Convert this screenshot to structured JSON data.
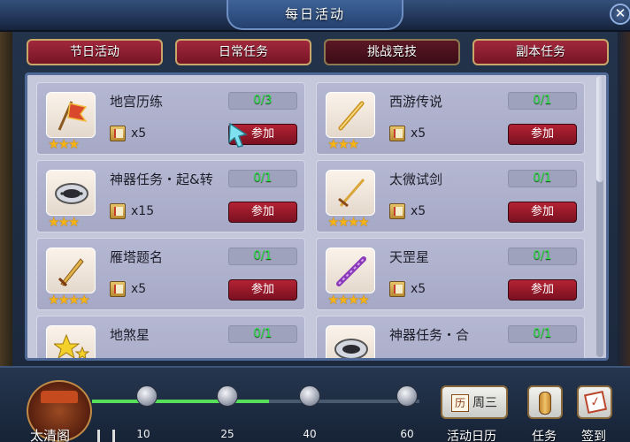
{
  "window": {
    "title": "每日活动",
    "close_glyph": "✕"
  },
  "tabs": [
    {
      "label": "节日活动",
      "active": false
    },
    {
      "label": "日常任务",
      "active": false
    },
    {
      "label": "挑战竞技",
      "active": true
    },
    {
      "label": "副本任务",
      "active": false
    }
  ],
  "activities": [
    {
      "name": "地宫历练",
      "progress": "0/3",
      "stars": "★★★",
      "reward_qty": "x5",
      "join_label": "参加",
      "icon": "banner-flag-icon"
    },
    {
      "name": "西游传说",
      "progress": "0/1",
      "stars": "★★★",
      "reward_qty": "x5",
      "join_label": "参加",
      "icon": "golden-flute-icon"
    },
    {
      "name": "神器任务・起&转",
      "progress": "0/1",
      "stars": "★★★",
      "reward_qty": "x15",
      "join_label": "参加",
      "icon": "artifact-disc-icon"
    },
    {
      "name": "太微试剑",
      "progress": "0/1",
      "stars": "★★★★",
      "reward_qty": "x5",
      "join_label": "参加",
      "icon": "golden-sword-icon"
    },
    {
      "name": "雁塔题名",
      "progress": "0/1",
      "stars": "★★★★",
      "reward_qty": "x5",
      "join_label": "参加",
      "icon": "golden-blade-icon"
    },
    {
      "name": "天罡星",
      "progress": "0/1",
      "stars": "★★★★",
      "reward_qty": "x5",
      "join_label": "参加",
      "icon": "purple-staff-icon"
    },
    {
      "name": "地煞星",
      "progress": "0/1",
      "stars": "★★",
      "reward_qty": "",
      "join_label": "",
      "icon": "star-icon"
    },
    {
      "name": "神器任务・合",
      "progress": "0/1",
      "stars": "",
      "reward_qty": "",
      "join_label": "",
      "icon": "artifact-disc-icon"
    }
  ],
  "bottom_bar": {
    "gate_label": "太清阁",
    "milestones": [
      "10",
      "25",
      "40",
      "60"
    ],
    "activity_calendar": {
      "day_glyph": "历",
      "week_text": "周三",
      "label": "活动日历"
    },
    "tasks_label": "任务",
    "signin": {
      "glyph": "✓",
      "label": "签到"
    }
  }
}
